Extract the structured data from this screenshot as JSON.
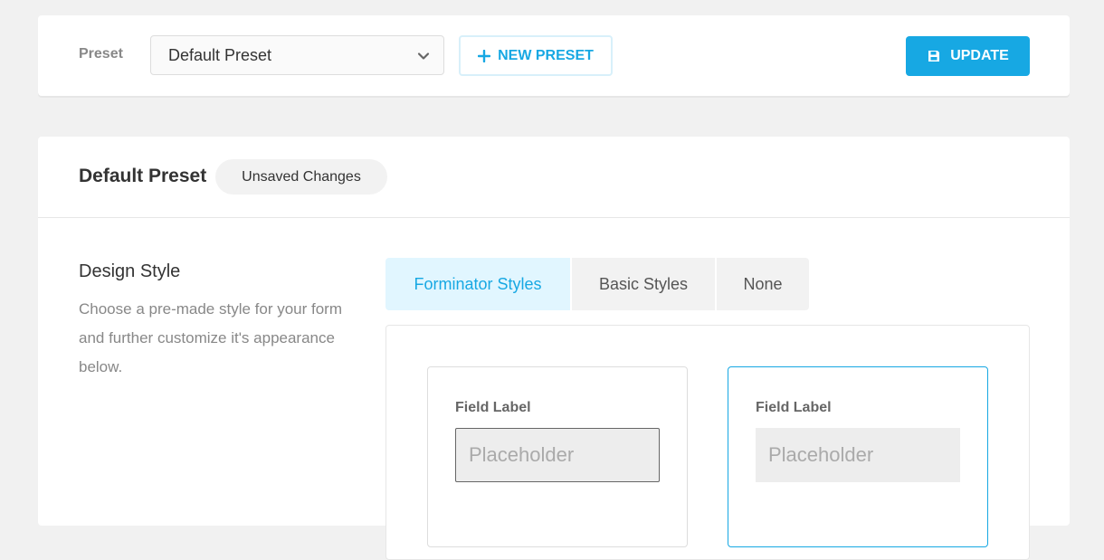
{
  "topbar": {
    "preset_label": "Preset",
    "preset_value": "Default Preset",
    "new_preset_label": "NEW PRESET",
    "update_label": "UPDATE"
  },
  "panel": {
    "title": "Default Preset",
    "status_badge": "Unsaved Changes",
    "design_style": {
      "title": "Design Style",
      "description": "Choose a pre-made style for your form and further customize it's appearance below."
    },
    "tabs": [
      {
        "label": "Forminator Styles",
        "active": true
      },
      {
        "label": "Basic Styles",
        "active": false
      },
      {
        "label": "None",
        "active": false
      }
    ],
    "style_cards": [
      {
        "field_label": "Field Label",
        "placeholder": "Placeholder",
        "selected": false
      },
      {
        "field_label": "Field Label",
        "placeholder": "Placeholder",
        "selected": true
      }
    ]
  },
  "colors": {
    "accent": "#17a8e3",
    "background": "#f1f1f1",
    "muted_text": "#888888"
  },
  "icons": {
    "select_arrow": "chevron-down-icon",
    "new_preset": "plus-icon",
    "update": "save-icon"
  }
}
